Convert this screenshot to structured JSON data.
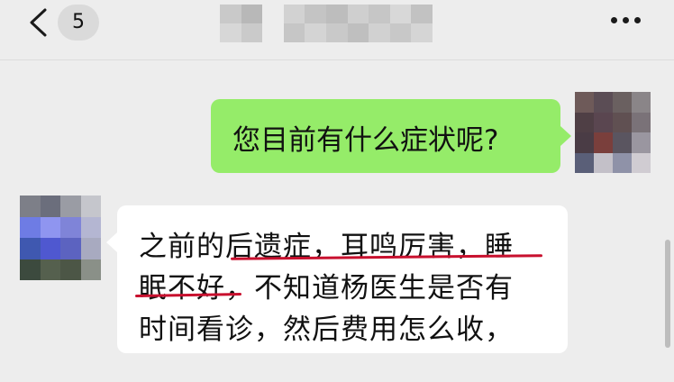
{
  "header": {
    "unread_count": "5",
    "back_icon": "chevron-left-icon",
    "more_icon": "more-dots-icon"
  },
  "messages": [
    {
      "direction": "outgoing",
      "text": "您目前有什么症状呢?"
    },
    {
      "direction": "incoming",
      "lines": [
        "之前的后遗症，耳鸣厉害，睡",
        "眠不好，不知道杨医生是否有",
        "时间看诊，然后费用怎么收，"
      ]
    }
  ],
  "colors": {
    "background": "#ededed",
    "outgoing_bubble": "#95ec69",
    "incoming_bubble": "#ffffff",
    "annotation_underline": "#c8102e"
  }
}
